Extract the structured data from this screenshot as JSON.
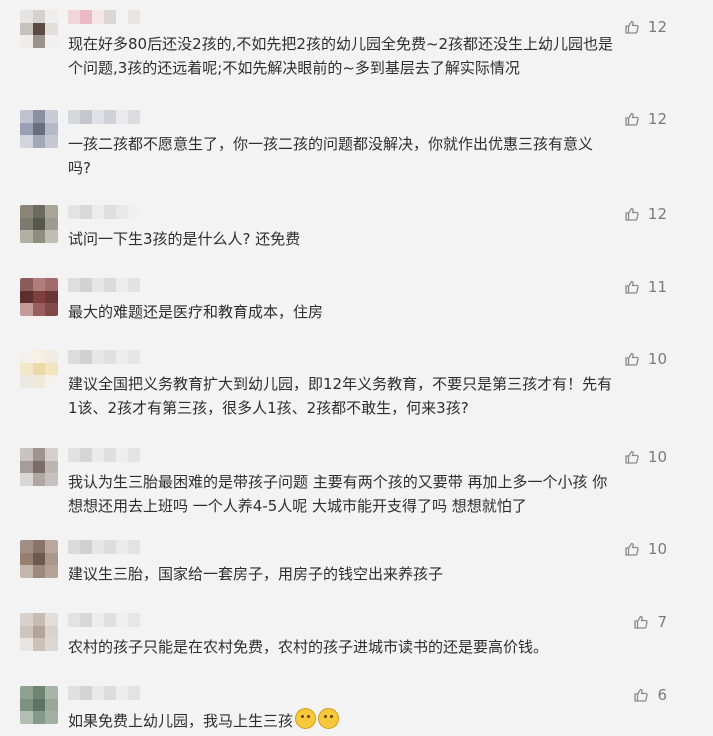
{
  "comments": [
    {
      "text": "现在好多80后还没2孩的,不如先把2孩的幼儿园全免费~2孩都还没生上幼儿园也是\n个问题,3孩的还远着呢;不如先解决眼前的~多到基层去了解实际情况",
      "likes": "12",
      "avatar_colors": [
        "#e6e3e1",
        "#d5d1ce",
        "#f0eeec",
        "#c8c2bd",
        "#5a4a43",
        "#e2deda",
        "#efecea",
        "#9c928c",
        "#f2f0ee"
      ],
      "name_colors": [
        "#f1d5dc",
        "#e9b9c5",
        "#f6e6ea",
        "#dcd6d6",
        "#f3f3f3",
        "#e7e4e4"
      ]
    },
    {
      "text": "一孩二孩都不愿意生了，你一孩二孩的问题都没解决，你就作出优惠三孩有意义\n吗?",
      "likes": "12",
      "avatar_colors": [
        "#bfc3cf",
        "#8d8fa3",
        "#c9ccd6",
        "#9aa0b3",
        "#6a6c80",
        "#b5b8c6",
        "#d3d5dd",
        "#a4a7b7",
        "#c5c8d2"
      ],
      "name_colors": [
        "#d7d8de",
        "#c6c7cd",
        "#e0e1e6",
        "#d0d1d6",
        "#eaeaee",
        "#dcdce0"
      ]
    },
    {
      "text": "试问一下生3孩的是什么人? 还免费",
      "likes": "12",
      "avatar_colors": [
        "#8a8577",
        "#6b6a5e",
        "#a9a596",
        "#7c7a6e",
        "#55564d",
        "#9d9b8e",
        "#b3b0a3",
        "#8f8c80",
        "#c0bdb1"
      ],
      "name_colors": [
        "#e4e4e4",
        "#d9d9d9",
        "#ececec",
        "#dedede",
        "#e8e8e8",
        "#f0f0f0"
      ]
    },
    {
      "text": "最大的难题还是医疗和教育成本，住房",
      "likes": "11",
      "avatar_colors": [
        "#8c5c5a",
        "#b07d7a",
        "#a06b68",
        "#5a2f2e",
        "#7d3f3c",
        "#6a3634",
        "#c39c98",
        "#9a5f5c",
        "#7f4a47"
      ],
      "name_colors": [
        "#dedede",
        "#d2d2d2",
        "#e6e6e6",
        "#dadada",
        "#ececec",
        "#e2e2e2"
      ]
    },
    {
      "text": "建议全国把义务教育扩大到幼儿园，即12年义务教育，不要只是第三孩才有！先有\n1该、2孩才有第三孩，很多人1孩、2孩都不敢生，何来3孩?",
      "likes": "10",
      "avatar_colors": [
        "#f4f1ec",
        "#f7efe0",
        "#f1ebe0",
        "#f3e7c9",
        "#ecd9a8",
        "#f2e4bf",
        "#ece9e3",
        "#f0e9da",
        "#f5f2ed"
      ],
      "name_colors": [
        "#dcdcdc",
        "#d1d1d1",
        "#e7e7e7",
        "#e0e0e0",
        "#ededed",
        "#e5e5e5"
      ]
    },
    {
      "text": "我认为生三胎最困难的是带孩子问题 主要有两个孩的又要带 再加上多一个小孩 你\n想想还用去上班吗 一个人养4-5人呢 大城市能开支得了吗 想想就怕了",
      "likes": "10",
      "avatar_colors": [
        "#c9c3c1",
        "#9e9390",
        "#d4cfcd",
        "#a79c99",
        "#7b6c69",
        "#bdb5b2",
        "#dad6d4",
        "#b0a7a4",
        "#c6c0be"
      ],
      "name_colors": [
        "#e1e1e1",
        "#d6d6d6",
        "#ebebeb",
        "#dfdfdf",
        "#eeeeee",
        "#e4e4e4"
      ]
    },
    {
      "text": "建议生三胎，国家给一套房子，用房子的钱空出来养孩子",
      "likes": "10",
      "avatar_colors": [
        "#a28f84",
        "#8a7568",
        "#b9a89e",
        "#95806f",
        "#6d5a4e",
        "#a9978c",
        "#c4b6ad",
        "#9d897c",
        "#b3a296"
      ],
      "name_colors": [
        "#dbdbdb",
        "#d0d0d0",
        "#e6e6e6",
        "#dddddd",
        "#ebebeb",
        "#e3e3e3"
      ]
    },
    {
      "text": "农村的孩子只能是在农村免费，农村的孩子进城市读书的还是要高价钱。",
      "likes": "7",
      "avatar_colors": [
        "#d9d2cc",
        "#c7bcb3",
        "#e2ddd8",
        "#cfc5bc",
        "#b2a497",
        "#dad3cd",
        "#e8e4e0",
        "#cbc1b8",
        "#ddd7d1"
      ],
      "name_colors": [
        "#e3e3e3",
        "#d7d7d7",
        "#ececec",
        "#e0e0e0",
        "#efefef",
        "#e7e7e7"
      ]
    },
    {
      "text": "如果免费上幼儿园，我马上生三孩",
      "likes": "6",
      "emojis": 2,
      "avatar_colors": [
        "#8fa292",
        "#6f8574",
        "#a6b6a8",
        "#7d917f",
        "#5f7364",
        "#98a99a",
        "#b1bfb2",
        "#869a89",
        "#a0b0a2"
      ],
      "name_colors": [
        "#e0e0e0",
        "#d4d4d4",
        "#e9e9e9",
        "#dcdcdc",
        "#ededed",
        "#e3e3e3"
      ]
    }
  ],
  "like_icon": "thumbs-up-icon"
}
